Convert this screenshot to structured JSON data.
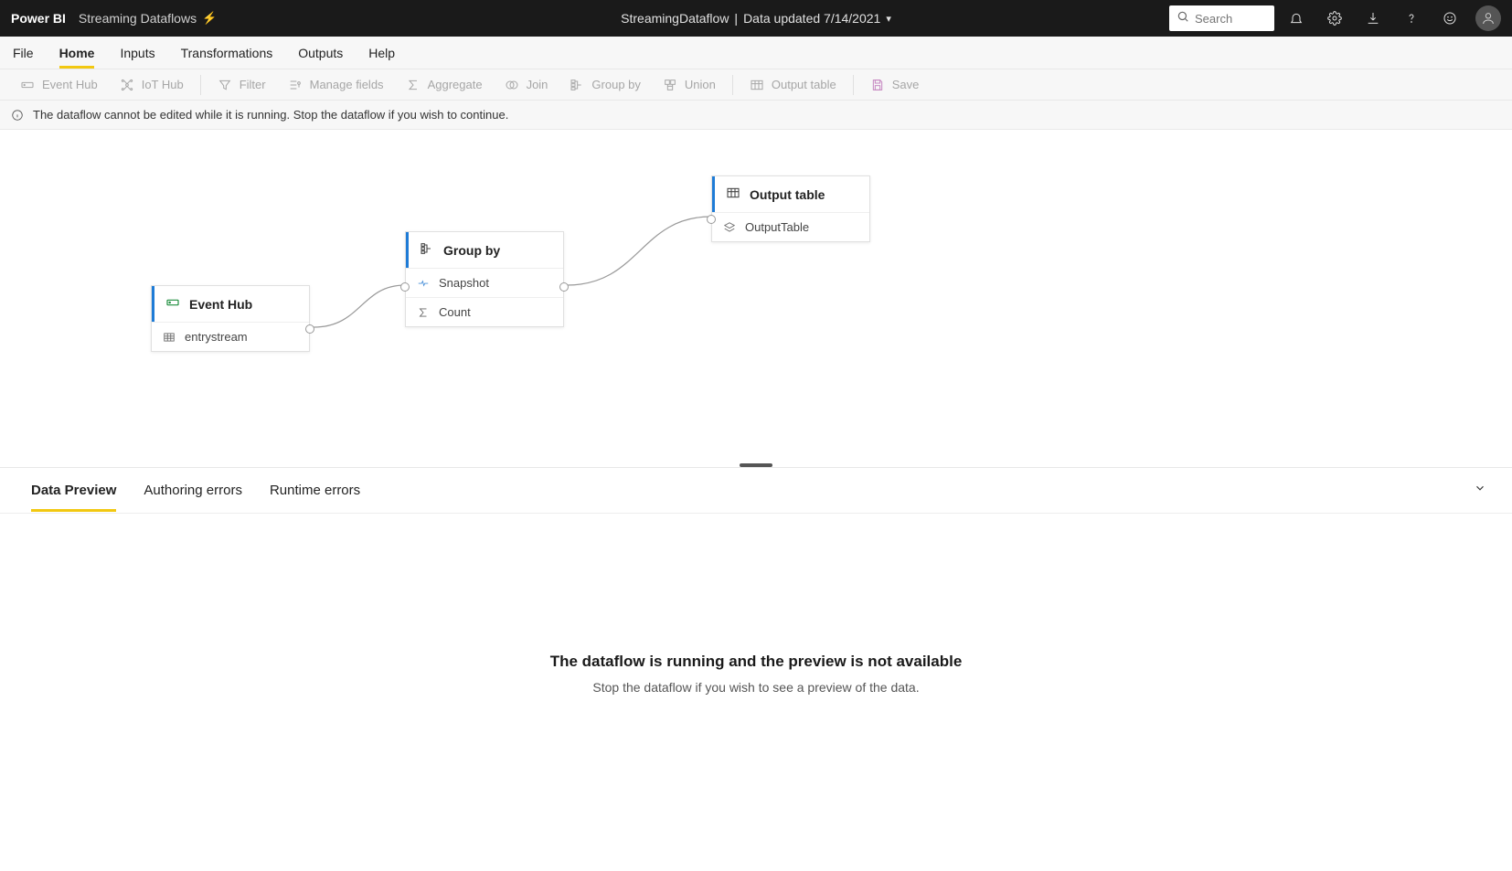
{
  "header": {
    "brand": "Power BI",
    "subtitle": "Streaming Dataflows",
    "center": {
      "name": "StreamingDataflow",
      "separator": "|",
      "updated": "Data updated 7/14/2021"
    },
    "search_placeholder": "Search"
  },
  "menu": {
    "items": [
      "File",
      "Home",
      "Inputs",
      "Transformations",
      "Outputs",
      "Help"
    ],
    "active_index": 1
  },
  "ribbon": {
    "event_hub": "Event Hub",
    "iot_hub": "IoT Hub",
    "filter": "Filter",
    "manage_fields": "Manage fields",
    "aggregate": "Aggregate",
    "join": "Join",
    "group_by": "Group by",
    "union": "Union",
    "output_table": "Output table",
    "save": "Save"
  },
  "info_bar": {
    "message": "The dataflow cannot be edited while it is running. Stop the dataflow if you wish to continue."
  },
  "canvas": {
    "nodes": {
      "event_hub": {
        "title": "Event Hub",
        "rows": [
          {
            "icon": "table",
            "label": "entrystream"
          }
        ]
      },
      "group_by": {
        "title": "Group by",
        "rows": [
          {
            "icon": "snapshot",
            "label": "Snapshot"
          },
          {
            "icon": "sigma",
            "label": "Count"
          }
        ]
      },
      "output": {
        "title": "Output table",
        "rows": [
          {
            "icon": "layers",
            "label": "OutputTable"
          }
        ]
      }
    }
  },
  "bottom": {
    "tabs": [
      "Data Preview",
      "Authoring errors",
      "Runtime errors"
    ],
    "active_index": 0,
    "preview": {
      "title": "The dataflow is running and the preview is not available",
      "subtitle": "Stop the dataflow if you wish to see a preview of the data."
    }
  }
}
